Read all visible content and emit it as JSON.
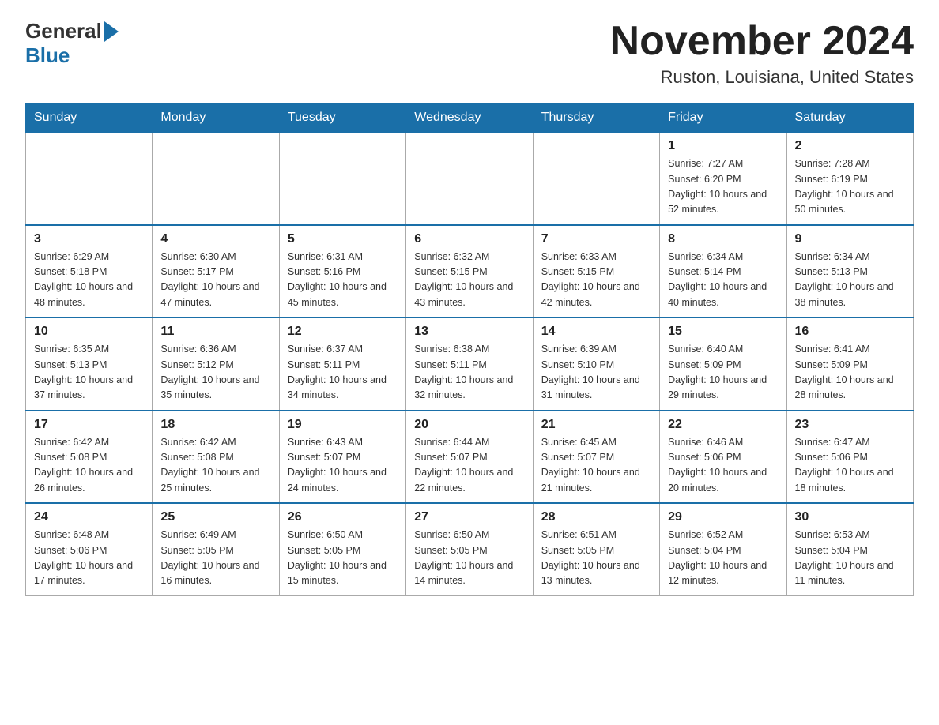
{
  "header": {
    "logo_general": "General",
    "logo_blue": "Blue",
    "month_title": "November 2024",
    "location": "Ruston, Louisiana, United States"
  },
  "calendar": {
    "days_of_week": [
      "Sunday",
      "Monday",
      "Tuesday",
      "Wednesday",
      "Thursday",
      "Friday",
      "Saturday"
    ],
    "weeks": [
      {
        "days": [
          {
            "num": "",
            "info": "",
            "empty": true
          },
          {
            "num": "",
            "info": "",
            "empty": true
          },
          {
            "num": "",
            "info": "",
            "empty": true
          },
          {
            "num": "",
            "info": "",
            "empty": true
          },
          {
            "num": "",
            "info": "",
            "empty": true
          },
          {
            "num": "1",
            "info": "Sunrise: 7:27 AM\nSunset: 6:20 PM\nDaylight: 10 hours and 52 minutes.",
            "empty": false
          },
          {
            "num": "2",
            "info": "Sunrise: 7:28 AM\nSunset: 6:19 PM\nDaylight: 10 hours and 50 minutes.",
            "empty": false
          }
        ]
      },
      {
        "days": [
          {
            "num": "3",
            "info": "Sunrise: 6:29 AM\nSunset: 5:18 PM\nDaylight: 10 hours and 48 minutes.",
            "empty": false
          },
          {
            "num": "4",
            "info": "Sunrise: 6:30 AM\nSunset: 5:17 PM\nDaylight: 10 hours and 47 minutes.",
            "empty": false
          },
          {
            "num": "5",
            "info": "Sunrise: 6:31 AM\nSunset: 5:16 PM\nDaylight: 10 hours and 45 minutes.",
            "empty": false
          },
          {
            "num": "6",
            "info": "Sunrise: 6:32 AM\nSunset: 5:15 PM\nDaylight: 10 hours and 43 minutes.",
            "empty": false
          },
          {
            "num": "7",
            "info": "Sunrise: 6:33 AM\nSunset: 5:15 PM\nDaylight: 10 hours and 42 minutes.",
            "empty": false
          },
          {
            "num": "8",
            "info": "Sunrise: 6:34 AM\nSunset: 5:14 PM\nDaylight: 10 hours and 40 minutes.",
            "empty": false
          },
          {
            "num": "9",
            "info": "Sunrise: 6:34 AM\nSunset: 5:13 PM\nDaylight: 10 hours and 38 minutes.",
            "empty": false
          }
        ]
      },
      {
        "days": [
          {
            "num": "10",
            "info": "Sunrise: 6:35 AM\nSunset: 5:13 PM\nDaylight: 10 hours and 37 minutes.",
            "empty": false
          },
          {
            "num": "11",
            "info": "Sunrise: 6:36 AM\nSunset: 5:12 PM\nDaylight: 10 hours and 35 minutes.",
            "empty": false
          },
          {
            "num": "12",
            "info": "Sunrise: 6:37 AM\nSunset: 5:11 PM\nDaylight: 10 hours and 34 minutes.",
            "empty": false
          },
          {
            "num": "13",
            "info": "Sunrise: 6:38 AM\nSunset: 5:11 PM\nDaylight: 10 hours and 32 minutes.",
            "empty": false
          },
          {
            "num": "14",
            "info": "Sunrise: 6:39 AM\nSunset: 5:10 PM\nDaylight: 10 hours and 31 minutes.",
            "empty": false
          },
          {
            "num": "15",
            "info": "Sunrise: 6:40 AM\nSunset: 5:09 PM\nDaylight: 10 hours and 29 minutes.",
            "empty": false
          },
          {
            "num": "16",
            "info": "Sunrise: 6:41 AM\nSunset: 5:09 PM\nDaylight: 10 hours and 28 minutes.",
            "empty": false
          }
        ]
      },
      {
        "days": [
          {
            "num": "17",
            "info": "Sunrise: 6:42 AM\nSunset: 5:08 PM\nDaylight: 10 hours and 26 minutes.",
            "empty": false
          },
          {
            "num": "18",
            "info": "Sunrise: 6:42 AM\nSunset: 5:08 PM\nDaylight: 10 hours and 25 minutes.",
            "empty": false
          },
          {
            "num": "19",
            "info": "Sunrise: 6:43 AM\nSunset: 5:07 PM\nDaylight: 10 hours and 24 minutes.",
            "empty": false
          },
          {
            "num": "20",
            "info": "Sunrise: 6:44 AM\nSunset: 5:07 PM\nDaylight: 10 hours and 22 minutes.",
            "empty": false
          },
          {
            "num": "21",
            "info": "Sunrise: 6:45 AM\nSunset: 5:07 PM\nDaylight: 10 hours and 21 minutes.",
            "empty": false
          },
          {
            "num": "22",
            "info": "Sunrise: 6:46 AM\nSunset: 5:06 PM\nDaylight: 10 hours and 20 minutes.",
            "empty": false
          },
          {
            "num": "23",
            "info": "Sunrise: 6:47 AM\nSunset: 5:06 PM\nDaylight: 10 hours and 18 minutes.",
            "empty": false
          }
        ]
      },
      {
        "days": [
          {
            "num": "24",
            "info": "Sunrise: 6:48 AM\nSunset: 5:06 PM\nDaylight: 10 hours and 17 minutes.",
            "empty": false
          },
          {
            "num": "25",
            "info": "Sunrise: 6:49 AM\nSunset: 5:05 PM\nDaylight: 10 hours and 16 minutes.",
            "empty": false
          },
          {
            "num": "26",
            "info": "Sunrise: 6:50 AM\nSunset: 5:05 PM\nDaylight: 10 hours and 15 minutes.",
            "empty": false
          },
          {
            "num": "27",
            "info": "Sunrise: 6:50 AM\nSunset: 5:05 PM\nDaylight: 10 hours and 14 minutes.",
            "empty": false
          },
          {
            "num": "28",
            "info": "Sunrise: 6:51 AM\nSunset: 5:05 PM\nDaylight: 10 hours and 13 minutes.",
            "empty": false
          },
          {
            "num": "29",
            "info": "Sunrise: 6:52 AM\nSunset: 5:04 PM\nDaylight: 10 hours and 12 minutes.",
            "empty": false
          },
          {
            "num": "30",
            "info": "Sunrise: 6:53 AM\nSunset: 5:04 PM\nDaylight: 10 hours and 11 minutes.",
            "empty": false
          }
        ]
      }
    ]
  }
}
